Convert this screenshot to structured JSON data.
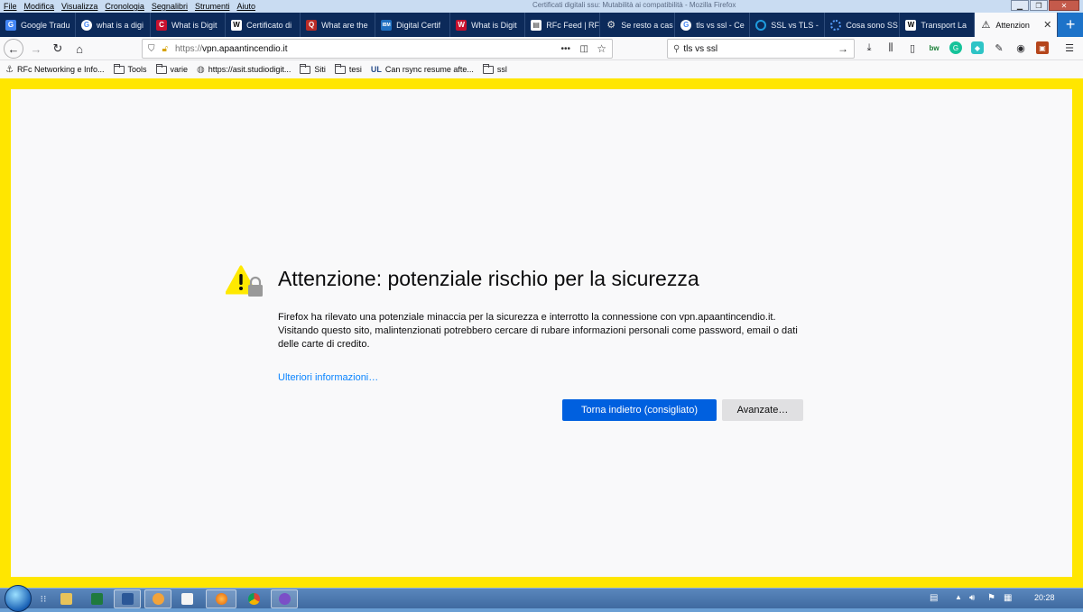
{
  "menubar": {
    "items": [
      "File",
      "Modifica",
      "Visualizza",
      "Cronologia",
      "Segnalibri",
      "Strumenti",
      "Aiuto"
    ],
    "window_title": "Certificati digitali ssu: Mutabilità ai compatibilità - Mozilla Firefox"
  },
  "tabs": [
    {
      "label": "Google Tradu",
      "favicon_color": "#4285f4",
      "favicon": "G"
    },
    {
      "label": "what is a digi",
      "favicon_color": "#ffffff",
      "favicon": "G"
    },
    {
      "label": "What is Digit",
      "favicon_color": "#c8102e",
      "favicon": "C"
    },
    {
      "label": "Certificato di",
      "favicon_color": "#ffffff",
      "favicon": "W"
    },
    {
      "label": "What are the",
      "favicon_color": "#b92b27",
      "favicon": "Q"
    },
    {
      "label": "Digital Certif",
      "favicon_color": "#1f70c1",
      "favicon": "IBM"
    },
    {
      "label": "What is Digit",
      "favicon_color": "#c8102e",
      "favicon": "W"
    },
    {
      "label": "RFc Feed | RF",
      "favicon_color": "#ffffff",
      "favicon": "R"
    },
    {
      "label": "Se resto a cas",
      "favicon_color": "#e8e8e8",
      "favicon": "S"
    },
    {
      "label": "tls vs ssl - Ce",
      "favicon_color": "#ffffff",
      "favicon": "G"
    },
    {
      "label": "SSL vs TLS -",
      "favicon_color": "#1f9bde",
      "favicon": "O"
    },
    {
      "label": "Cosa sono SS",
      "favicon_color": "#2a6fd6",
      "favicon": "O"
    },
    {
      "label": "Transport La",
      "favicon_color": "#ffffff",
      "favicon": "W"
    },
    {
      "label": "Attenzion",
      "favicon_color": "#0c0c0d",
      "favicon": "!",
      "active": true
    }
  ],
  "navbar": {
    "url_scheme": "https://",
    "url_host": "vpn.apaantincendio.it",
    "search_value": "tls vs ssl"
  },
  "bookmarks": [
    {
      "label": "RFc Networking e Info...",
      "icon": "rfc-icon"
    },
    {
      "label": "Tools",
      "icon": "folder-icon"
    },
    {
      "label": "varie",
      "icon": "folder-icon"
    },
    {
      "label": "https://asit.studiodigit...",
      "icon": "globe-icon"
    },
    {
      "label": "Siti",
      "icon": "folder-icon"
    },
    {
      "label": "tesi",
      "icon": "folder-icon"
    },
    {
      "label": "Can rsync resume afte...",
      "icon": "ul-icon"
    },
    {
      "label": "ssl",
      "icon": "folder-icon"
    }
  ],
  "error_page": {
    "title": "Attenzione: potenziale rischio per la sicurezza",
    "description": "Firefox ha rilevato una potenziale minaccia per la sicurezza e interrotto la connessione con vpn.apaantincendio.it. Visitando questo sito, malintenzionati potrebbero cercare di rubare informazioni personali come password, email o dati delle carte di credito.",
    "learn_more": "Ulteriori informazioni…",
    "back_button": "Torna indietro (consigliato)",
    "advanced_button": "Avanzate…"
  },
  "colors": {
    "frame_highlight": "#ffe600",
    "primary_button": "#0060df",
    "link": "#0a84ff",
    "tab_strip": "#0c2a5a"
  },
  "taskbar": {
    "clock": "20:28"
  }
}
